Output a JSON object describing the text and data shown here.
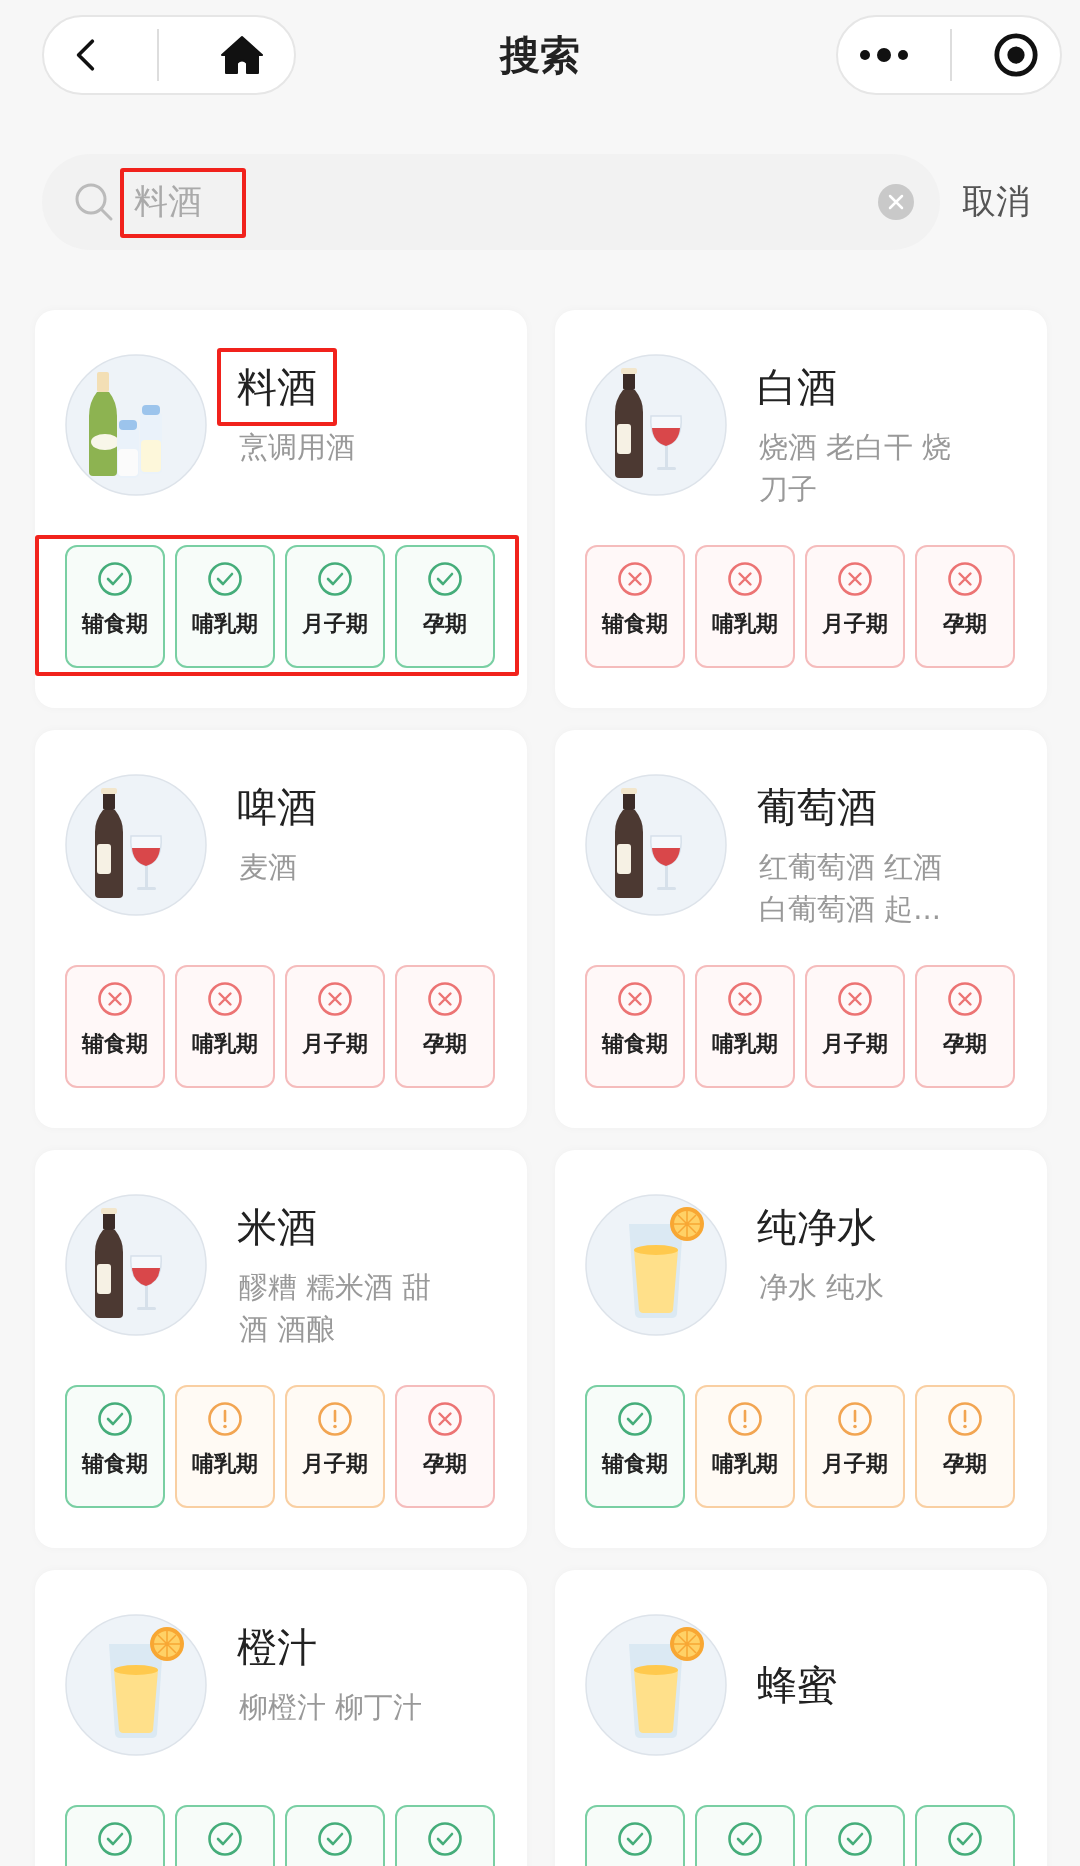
{
  "header": {
    "title": "搜索"
  },
  "search": {
    "value": "料酒",
    "highlighted": true,
    "cancel": "取消"
  },
  "items": [
    {
      "name": "料酒",
      "aliases": [
        "烹调用酒"
      ],
      "kind": "cooking-wine",
      "name_highlighted": true,
      "statuses_highlighted": true,
      "statuses": [
        {
          "label": "辅食期",
          "kind": "ok"
        },
        {
          "label": "哺乳期",
          "kind": "ok"
        },
        {
          "label": "月子期",
          "kind": "ok"
        },
        {
          "label": "孕期",
          "kind": "ok"
        }
      ]
    },
    {
      "name": "白酒",
      "aliases": [
        "烧酒 老白干 烧",
        "刀子"
      ],
      "kind": "wine",
      "name_highlighted": false,
      "statuses_highlighted": false,
      "statuses": [
        {
          "label": "辅食期",
          "kind": "no"
        },
        {
          "label": "哺乳期",
          "kind": "no"
        },
        {
          "label": "月子期",
          "kind": "no"
        },
        {
          "label": "孕期",
          "kind": "no"
        }
      ]
    },
    {
      "name": "啤酒",
      "aliases": [
        "麦酒"
      ],
      "kind": "wine",
      "name_highlighted": false,
      "statuses_highlighted": false,
      "statuses": [
        {
          "label": "辅食期",
          "kind": "no"
        },
        {
          "label": "哺乳期",
          "kind": "no"
        },
        {
          "label": "月子期",
          "kind": "no"
        },
        {
          "label": "孕期",
          "kind": "no"
        }
      ]
    },
    {
      "name": "葡萄酒",
      "aliases": [
        "红葡萄酒 红酒",
        "白葡萄酒 起..."
      ],
      "kind": "wine",
      "name_highlighted": false,
      "statuses_highlighted": false,
      "statuses": [
        {
          "label": "辅食期",
          "kind": "no"
        },
        {
          "label": "哺乳期",
          "kind": "no"
        },
        {
          "label": "月子期",
          "kind": "no"
        },
        {
          "label": "孕期",
          "kind": "no"
        }
      ]
    },
    {
      "name": "米酒",
      "aliases": [
        "醪糟 糯米酒 甜",
        "酒 酒酿"
      ],
      "kind": "wine",
      "name_highlighted": false,
      "statuses_highlighted": false,
      "statuses": [
        {
          "label": "辅食期",
          "kind": "ok"
        },
        {
          "label": "哺乳期",
          "kind": "warn"
        },
        {
          "label": "月子期",
          "kind": "warn"
        },
        {
          "label": "孕期",
          "kind": "no"
        }
      ]
    },
    {
      "name": "纯净水",
      "aliases": [
        "净水 纯水"
      ],
      "kind": "juice",
      "name_highlighted": false,
      "statuses_highlighted": false,
      "statuses": [
        {
          "label": "辅食期",
          "kind": "ok"
        },
        {
          "label": "哺乳期",
          "kind": "warn"
        },
        {
          "label": "月子期",
          "kind": "warn"
        },
        {
          "label": "孕期",
          "kind": "warn"
        }
      ]
    },
    {
      "name": "橙汁",
      "aliases": [
        "柳橙汁 柳丁汁"
      ],
      "kind": "juice",
      "name_highlighted": false,
      "statuses_highlighted": false,
      "statuses": [
        {
          "kind": "ok"
        },
        {
          "kind": "ok"
        },
        {
          "kind": "ok"
        },
        {
          "kind": "ok"
        }
      ]
    },
    {
      "name": "蜂蜜",
      "kind": "juice",
      "name_highlighted": false,
      "statuses_highlighted": false,
      "statuses": [
        {
          "kind": "ok"
        },
        {
          "kind": "ok"
        },
        {
          "kind": "ok"
        },
        {
          "kind": "ok"
        }
      ]
    }
  ]
}
